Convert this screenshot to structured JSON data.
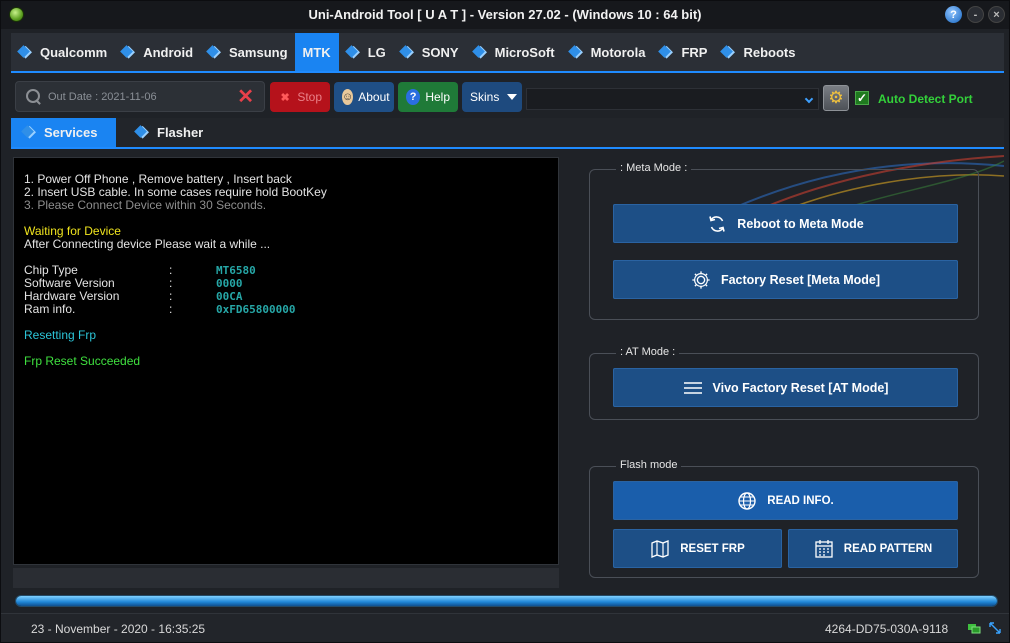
{
  "window": {
    "title": "Uni-Android Tool [ U A T ] - Version 27.02  -  (Windows 10  : 64 bit)",
    "help": "?",
    "minimize": "-",
    "close": "×"
  },
  "brand_tabs": [
    "Qualcomm",
    "Android",
    "Samsung",
    "MTK",
    "LG",
    "SONY",
    "MicroSoft",
    "Motorola",
    "FRP",
    "Reboots"
  ],
  "toolbar": {
    "search_placeholder": "Out Date : 2021-11-06",
    "stop": "Stop",
    "about": "About",
    "help": "Help",
    "skins": "Skins",
    "port_value": "",
    "auto_detect": "Auto Detect Port",
    "auto_detect_checked": true
  },
  "sub_tabs": [
    "Services",
    "Flasher"
  ],
  "console": {
    "line1": "1. Power Off Phone , Remove battery , Insert back",
    "line2": "2. Insert USB cable. In some cases require hold BootKey",
    "line3": "3. Please Connect Device within 30 Seconds.",
    "waiting": "Waiting for Device",
    "after": "After Connecting device Please wait a while ...",
    "info": [
      {
        "key": "Chip Type",
        "sep": ":",
        "value": "MT6580"
      },
      {
        "key": "Software Version",
        "sep": ":",
        "value": "0000"
      },
      {
        "key": "Hardware Version",
        "sep": ":",
        "value": "00CA"
      },
      {
        "key": "Ram info.",
        "sep": ":",
        "value": "0xFD65800000"
      }
    ],
    "resetting": "Resetting Frp",
    "success": "Frp Reset Succeeded"
  },
  "meta_mode": {
    "legend": ": Meta Mode :",
    "reboot": "Reboot to Meta Mode",
    "factory": "Factory Reset [Meta Mode]"
  },
  "at_mode": {
    "legend": ": AT Mode :",
    "vivo": "Vivo Factory Reset [AT Mode]"
  },
  "flash_mode": {
    "legend": "Flash mode",
    "read_info": "READ INFO.",
    "reset_frp": "RESET FRP",
    "read_pattern": "READ PATTERN"
  },
  "progress": {
    "percent": 100
  },
  "status": {
    "date": "23 - November - 2020  -  16:35:25",
    "id": "4264-DD75-030A-9118"
  },
  "colors": {
    "accent": "#1a84f2",
    "stop": "#b5121b",
    "help": "#1f7a38",
    "success": "#3fe03f"
  }
}
